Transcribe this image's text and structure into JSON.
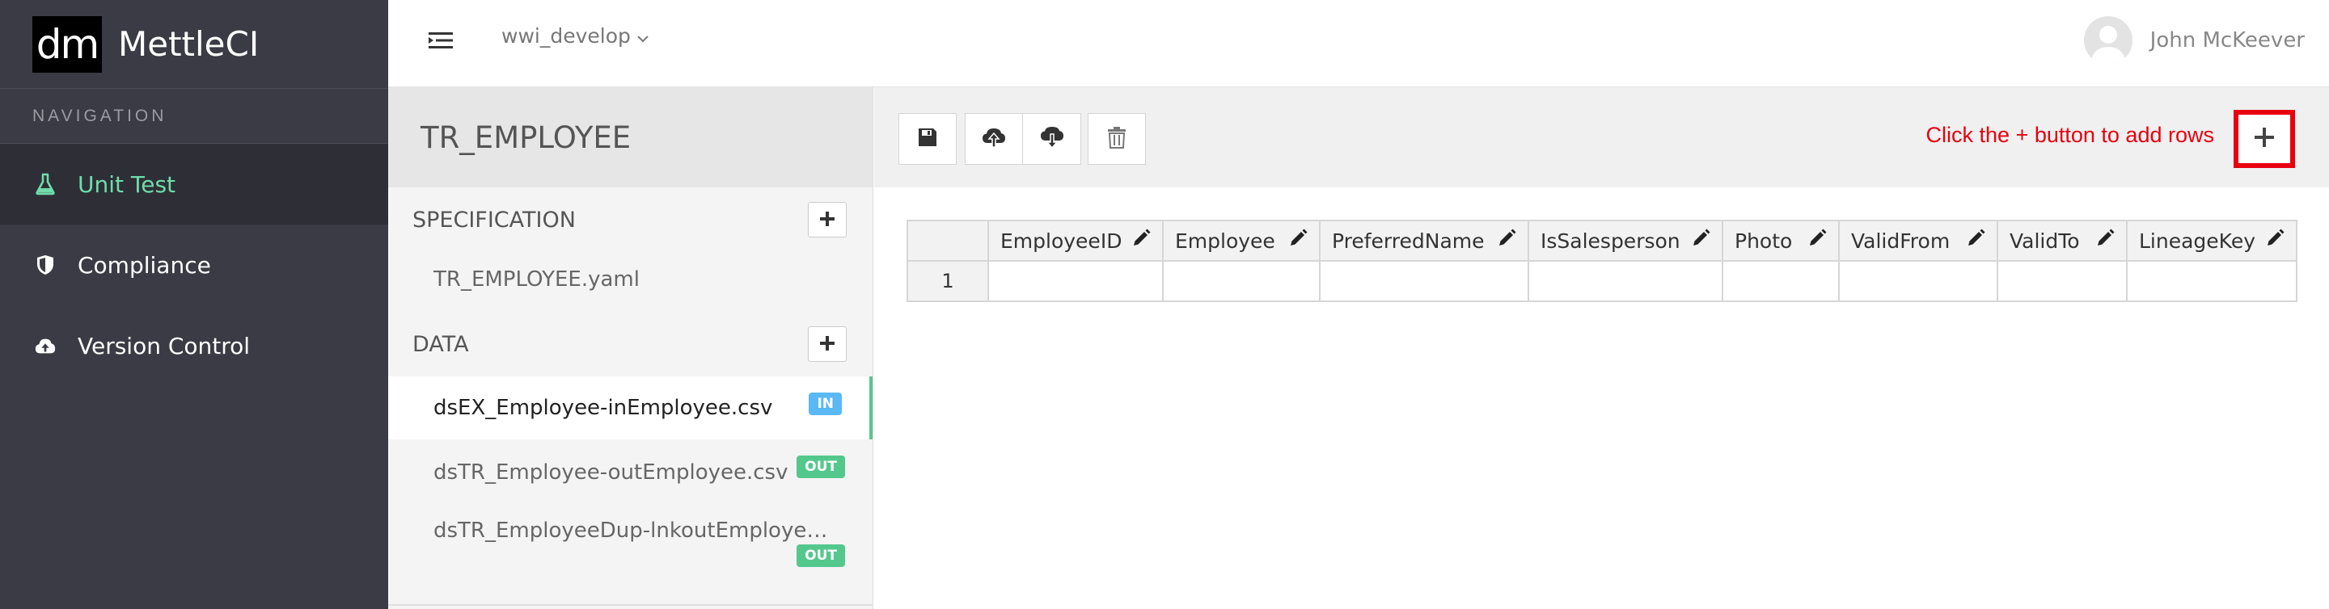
{
  "app": {
    "logo_text": "dm",
    "name": "MettleCI"
  },
  "nav": {
    "header": "NAVIGATION",
    "items": [
      {
        "label": "Unit Test",
        "icon": "flask-icon",
        "active": true
      },
      {
        "label": "Compliance",
        "icon": "shield-icon",
        "active": false
      },
      {
        "label": "Version Control",
        "icon": "cloud-upload-icon",
        "active": false
      }
    ]
  },
  "topbar": {
    "branch": "wwi_develop",
    "user_name": "John McKeever"
  },
  "file_panel": {
    "title": "TR_EMPLOYEE",
    "specification": {
      "header": "SPECIFICATION",
      "files": [
        "TR_EMPLOYEE.yaml"
      ]
    },
    "data": {
      "header": "DATA",
      "files": [
        {
          "name": "dsEX_Employee-inEmployee.csv",
          "badge": "IN"
        },
        {
          "name": "dsTR_Employee-outEmployee.csv",
          "badge": "OUT"
        },
        {
          "name": "dsTR_EmployeeDup-lnkoutEmployeeDup.csv",
          "badge": "OUT"
        }
      ]
    }
  },
  "toolbar": {
    "buttons": [
      "save-icon",
      "upload-icon",
      "download-icon",
      "trash-icon"
    ],
    "hint": "Click the + button to add rows"
  },
  "grid": {
    "columns": [
      "EmployeeID",
      "Employee",
      "PreferredName",
      "IsSalesperson",
      "Photo",
      "ValidFrom",
      "ValidTo",
      "LineageKey"
    ],
    "rows": [
      {
        "number": "1",
        "cells": [
          "",
          "",
          "",
          "",
          "",
          "",
          "",
          ""
        ]
      }
    ]
  },
  "colors": {
    "sidebar_bg": "#3a3b44",
    "active_accent": "#6fdcaa",
    "badge_in": "#5ab8f5",
    "badge_out": "#54c88c",
    "hint_red": "#e8000f"
  }
}
